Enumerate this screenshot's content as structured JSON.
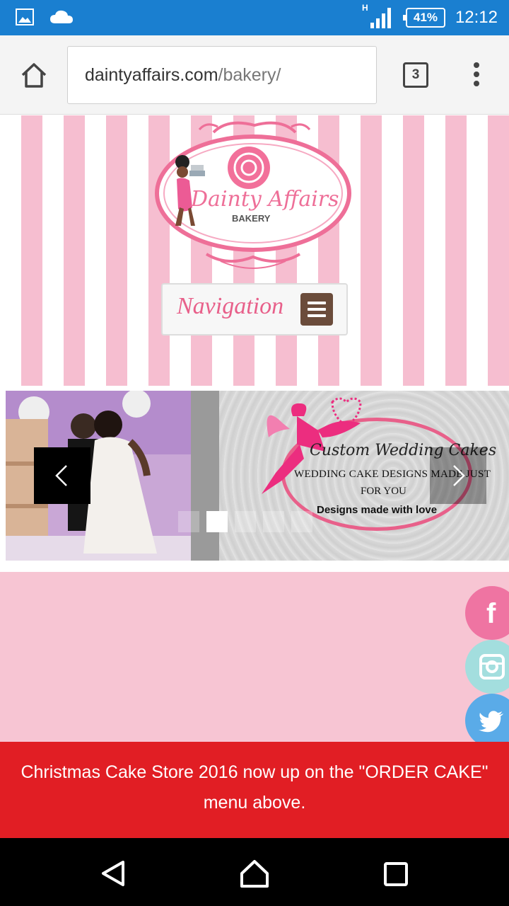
{
  "status_bar": {
    "time": "12:12",
    "battery": "41%",
    "network": "H"
  },
  "browser": {
    "url_domain": "daintyaffairs.com",
    "url_path": "/bakery/",
    "tab_count": "3"
  },
  "header": {
    "logo_text": "Dainty Affairs",
    "logo_subtext": "BAKERY",
    "navigation_label": "Navigation"
  },
  "slider": {
    "promo_title": "Custom Wedding Cakes",
    "promo_line1": "WEDDING CAKE DESIGNS MADE JUST",
    "promo_line2": "FOR YOU",
    "promo_line3": "Designs made with love",
    "prev_icon": "chevron-left-icon",
    "next_icon": "chevron-right-icon"
  },
  "social": {
    "facebook": "f",
    "items": [
      "facebook-icon",
      "instagram-icon",
      "twitter-icon"
    ]
  },
  "banner": {
    "text": "Christmas Cake Store 2016 now up on the \"ORDER CAKE\" menu above."
  },
  "colors": {
    "status_bar": "#1a7fd0",
    "stripe_pink": "#f6bed0",
    "brand_pink": "#e8608a",
    "banner_red": "#e11e24",
    "nav_brown": "#6b4c3b"
  }
}
